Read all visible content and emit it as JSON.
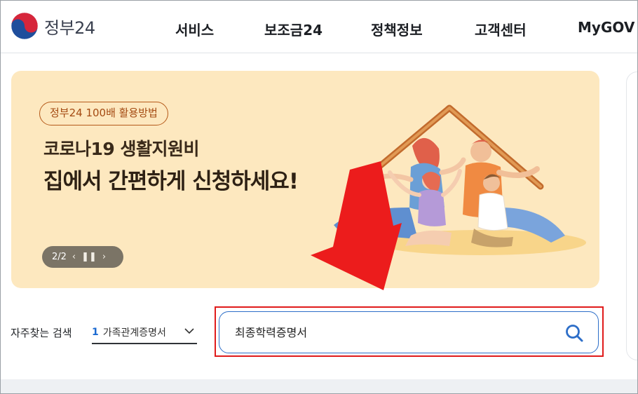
{
  "header": {
    "logo_text": "정부24",
    "nav": [
      "서비스",
      "보조금24",
      "정책정보",
      "고객센터",
      "MyGOV"
    ]
  },
  "banner": {
    "pill": "정부24 100배 활용방법",
    "subtitle": "코로나19 생활지원비",
    "title": "집에서 간편하게 신청하세요!",
    "slide_counter": "2/2",
    "background_color": "#fde8bf"
  },
  "search": {
    "popular_label": "자주찾는 검색",
    "popular_rank": "1",
    "popular_item": "가족관계증명서",
    "input_value": "최종학력증명서",
    "accent_color": "#2d6ec8"
  },
  "annotation": {
    "highlight_color": "#e01b1b"
  }
}
